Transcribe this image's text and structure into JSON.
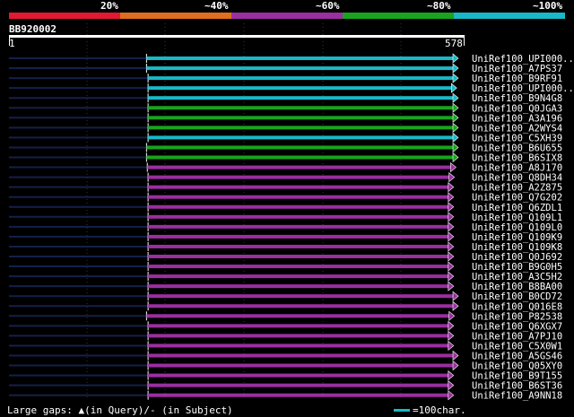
{
  "identity_scale": {
    "labels": [
      "20%",
      "~40%",
      "~60%",
      "~80%",
      "~100%"
    ],
    "colors": [
      "#e31932",
      "#e06e1e",
      "#9a2fa0",
      "#19a31e",
      "#19b8c6"
    ]
  },
  "query": {
    "id": "BB920002",
    "start": "1",
    "end": "578",
    "length": 578
  },
  "faint_text": "",
  "rows": [
    {
      "label": "UniRef100_UPI000..",
      "qstart": 178,
      "qend": 578,
      "identity": "~100%"
    },
    {
      "label": "UniRef100_A7PS37",
      "qstart": 178,
      "qend": 578,
      "identity": "~100%"
    },
    {
      "label": "UniRef100_B9RF91",
      "qstart": 180,
      "qend": 578,
      "identity": "~100%"
    },
    {
      "label": "UniRef100_UPI000..",
      "qstart": 180,
      "qend": 576,
      "identity": "~100%"
    },
    {
      "label": "UniRef100_B9N4G8",
      "qstart": 180,
      "qend": 578,
      "identity": "~100%"
    },
    {
      "label": "UniRef100_Q0JGA3",
      "qstart": 180,
      "qend": 578,
      "identity": "~80%"
    },
    {
      "label": "UniRef100_A3A196",
      "qstart": 180,
      "qend": 578,
      "identity": "~80%"
    },
    {
      "label": "UniRef100_A2WYS4",
      "qstart": 180,
      "qend": 578,
      "identity": "~80%"
    },
    {
      "label": "UniRef100_C5XH39",
      "qstart": 180,
      "qend": 578,
      "identity": "~100%"
    },
    {
      "label": "UniRef100_B6U655",
      "qstart": 178,
      "qend": 578,
      "identity": "~80%"
    },
    {
      "label": "UniRef100_B6SIX8",
      "qstart": 178,
      "qend": 578,
      "identity": "~80%"
    },
    {
      "label": "UniRef100_A8J170",
      "qstart": 179,
      "qend": 575,
      "identity": "~60%"
    },
    {
      "label": "UniRef100_Q8DH34",
      "qstart": 180,
      "qend": 573,
      "identity": "~60%"
    },
    {
      "label": "UniRef100_A2Z875",
      "qstart": 180,
      "qend": 572,
      "identity": "~60%"
    },
    {
      "label": "UniRef100_Q7G202",
      "qstart": 180,
      "qend": 572,
      "identity": "~60%"
    },
    {
      "label": "UniRef100_Q6ZDL1",
      "qstart": 180,
      "qend": 572,
      "identity": "~60%"
    },
    {
      "label": "UniRef100_Q109L1",
      "qstart": 180,
      "qend": 572,
      "identity": "~60%"
    },
    {
      "label": "UniRef100_Q109L0",
      "qstart": 180,
      "qend": 572,
      "identity": "~60%"
    },
    {
      "label": "UniRef100_Q109K9",
      "qstart": 180,
      "qend": 572,
      "identity": "~60%"
    },
    {
      "label": "UniRef100_Q109K8",
      "qstart": 180,
      "qend": 572,
      "identity": "~60%"
    },
    {
      "label": "UniRef100_Q0J692",
      "qstart": 180,
      "qend": 572,
      "identity": "~60%"
    },
    {
      "label": "UniRef100_B9G0H5",
      "qstart": 180,
      "qend": 572,
      "identity": "~60%"
    },
    {
      "label": "UniRef100_A3C5H2",
      "qstart": 180,
      "qend": 572,
      "identity": "~60%"
    },
    {
      "label": "UniRef100_B8BA00",
      "qstart": 180,
      "qend": 572,
      "identity": "~60%"
    },
    {
      "label": "UniRef100_B0CD72",
      "qstart": 180,
      "qend": 578,
      "identity": "~60%"
    },
    {
      "label": "UniRef100_Q016E8",
      "qstart": 180,
      "qend": 578,
      "identity": "~60%"
    },
    {
      "label": "UniRef100_P82538",
      "qstart": 178,
      "qend": 573,
      "identity": "~60%"
    },
    {
      "label": "UniRef100_Q6XGX7",
      "qstart": 180,
      "qend": 572,
      "identity": "~60%"
    },
    {
      "label": "UniRef100_A7PJ10",
      "qstart": 180,
      "qend": 572,
      "identity": "~60%"
    },
    {
      "label": "UniRef100_C5X0W1",
      "qstart": 180,
      "qend": 572,
      "identity": "~60%"
    },
    {
      "label": "UniRef100_A5GS46",
      "qstart": 180,
      "qend": 578,
      "identity": "~60%"
    },
    {
      "label": "UniRef100_Q05XY0",
      "qstart": 180,
      "qend": 578,
      "identity": "~60%"
    },
    {
      "label": "UniRef100_B9T155",
      "qstart": 180,
      "qend": 572,
      "identity": "~60%"
    },
    {
      "label": "UniRef100_B6ST36",
      "qstart": 180,
      "qend": 572,
      "identity": "~60%"
    },
    {
      "label": "UniRef100_A9NN18",
      "qstart": 180,
      "qend": 572,
      "identity": "~60%"
    }
  ],
  "footer": {
    "gaps_prefix": "Large gaps:",
    "gaps_query": "(in Query)/",
    "gaps_subject": "- (in Subject)",
    "legend_text": "=100char.",
    "legend_color": "#19b8c6"
  }
}
